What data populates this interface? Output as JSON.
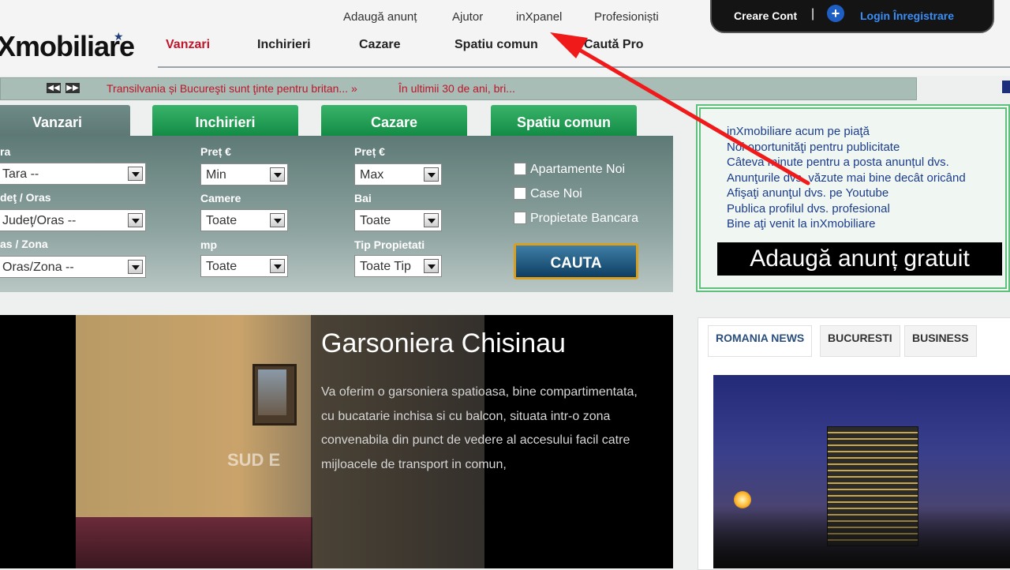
{
  "header": {
    "logo_text": "Xmobiliare",
    "top_links": [
      "Adaugă anunț",
      "Ajutor",
      "inXpanel",
      "Profesioniști"
    ],
    "nav": [
      "Vanzari",
      "Inchirieri",
      "Cazare",
      "Spatiu comun",
      "Cautǎ Pro"
    ]
  },
  "account": {
    "create": "Creare Cont",
    "separator": "|",
    "plus": "+",
    "login": "Login Înregistrare"
  },
  "ticker": {
    "items": [
      "Transilvania și Bucureşti sunt ţinte pentru britan... »",
      "În ultimii 30 de ani, bri..."
    ]
  },
  "search": {
    "tabs": [
      "Vanzari",
      "Inchirieri",
      "Cazare",
      "Spatiu comun"
    ],
    "labels": {
      "tara": "ra",
      "judet": "deţ / Oras",
      "oras": "as / Zona",
      "pret1": "Preț €",
      "camere": "Camere",
      "mp": "mp",
      "pret2": "Preț €",
      "bai": "Bai",
      "tip": "Tip Propietati"
    },
    "values": {
      "tara": "Tara --",
      "judet": "Judeţ/Oras --",
      "oras": "Oras/Zona --",
      "pret_min": "Min",
      "camere": "Toate",
      "mp": "Toate",
      "pret_max": "Max",
      "bai": "Toate",
      "tip": "Toate Tip"
    },
    "checkboxes": [
      "Apartamente Noi",
      "Case Noi",
      "Propietate Bancara"
    ],
    "submit": "CAUTA"
  },
  "promo": {
    "links": [
      "inXmobiliare acum pe piaţă",
      "Noi oportunităţi pentru publicitate",
      "Câteva minute pentru a posta anunțul dvs.",
      "Anunţurile dvs. văzute mai bine decât oricând",
      "Afişaţi anunţul dvs. pe Youtube",
      "Publica profilul dvs. profesional",
      "Bine aţi venit la inXmobiliare"
    ],
    "cta": "Adaugă anunț gratuit"
  },
  "slide": {
    "title": "Garsoniera Chisinau",
    "description": "Va oferim o garsoniera spatioasa, bine compartimentata, cu bucatarie inchisa si cu balcon, situata intr-o zona convenabila din punct de vedere al accesului facil catre mijloacele de transport in comun,",
    "watermark": "SUD E"
  },
  "news": {
    "tabs": [
      "ROMANIA NEWS",
      "BUCURESTI",
      "BUSINESS"
    ]
  },
  "colors": {
    "accent_red": "#c0152a",
    "tab_green": "#128a44",
    "arrow_red": "#f01a1a"
  }
}
